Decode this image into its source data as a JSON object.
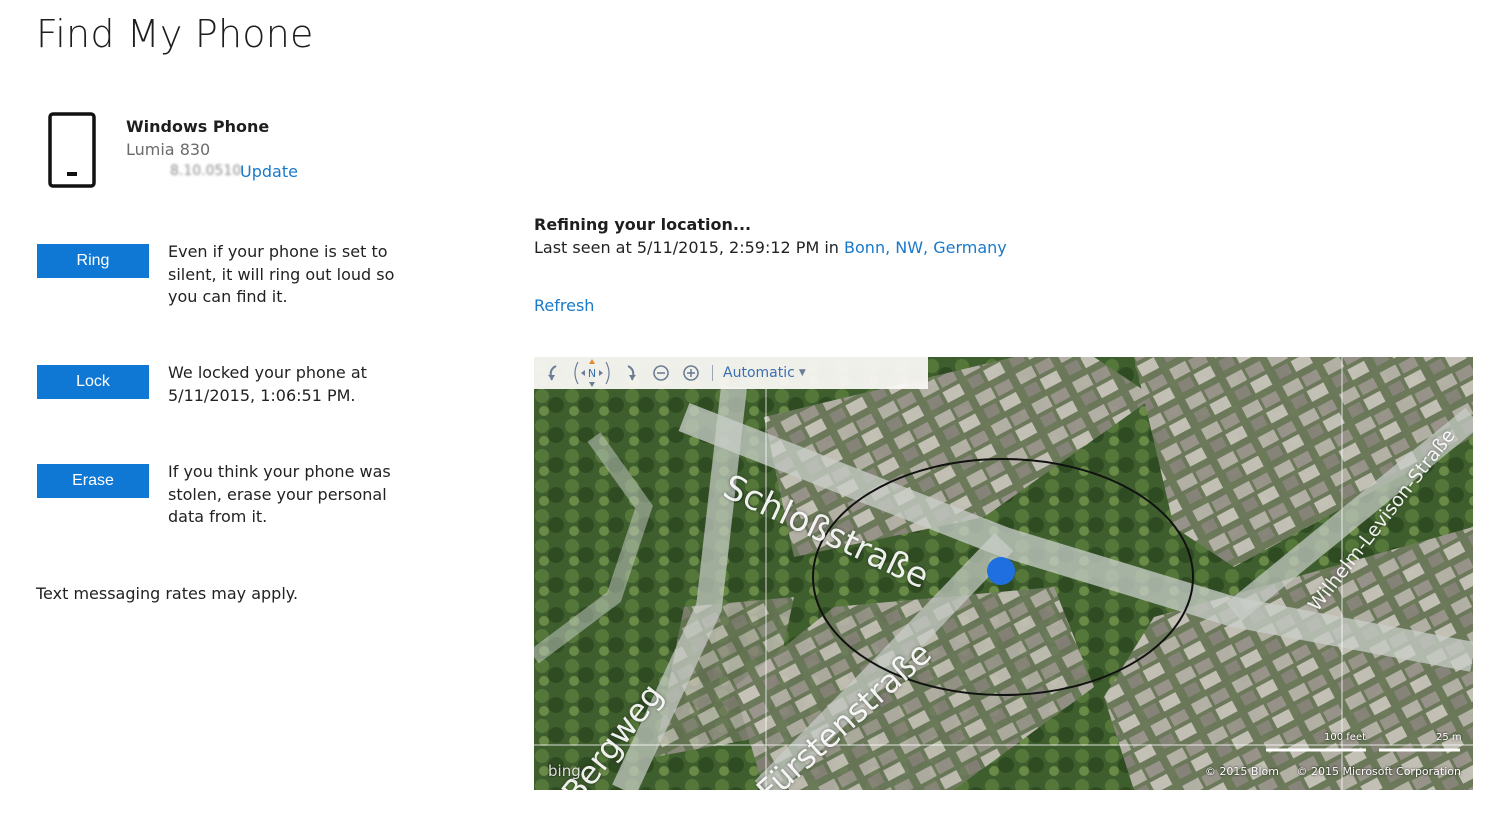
{
  "page": {
    "title": "Find My Phone"
  },
  "device": {
    "name": "Windows Phone",
    "model": "Lumia 830",
    "os_version": "8.10.0510",
    "update_label": "Update"
  },
  "actions": {
    "ring": {
      "label": "Ring",
      "description": "Even if your phone is set to silent, it will ring out loud so you can find it."
    },
    "lock": {
      "label": "Lock",
      "description": "We locked your phone at 5/11/2015, 1:06:51 PM."
    },
    "erase": {
      "label": "Erase",
      "description": "If you think your phone was stolen, erase your personal data from it."
    }
  },
  "note": "Text messaging rates may apply.",
  "location": {
    "status": "Refining your location...",
    "last_seen_prefix": "Last seen at 5/11/2015, 2:59:12 PM in",
    "place": "Bonn, NW, Germany",
    "refresh_label": "Refresh"
  },
  "map": {
    "mode_label": "Automatic",
    "compass_label": "N",
    "streets": [
      "Schloßstraße",
      "Fürstenstraße",
      "Wilhelm-Levison-Straße",
      "Bergweg"
    ],
    "scale_imperial": "100 feet",
    "scale_metric": "25 m",
    "copyright_1": "© 2015 Blom",
    "copyright_2": "© 2015 Microsoft Corporation",
    "provider": "bing",
    "marker_color": "#1f6fe0"
  },
  "colors": {
    "accent": "#0f78d4",
    "link": "#1979ca"
  }
}
